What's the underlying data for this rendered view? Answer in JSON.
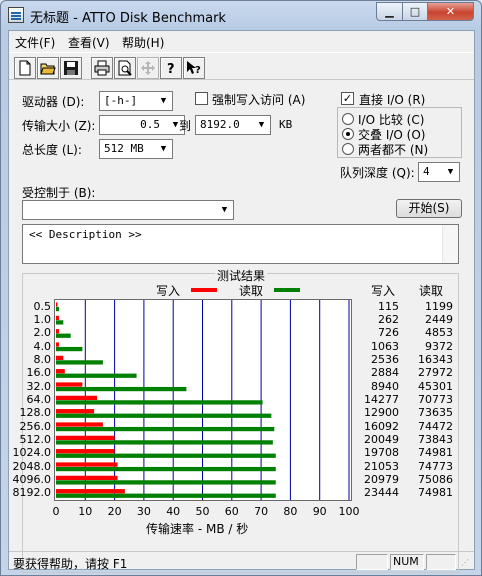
{
  "window": {
    "title": "无标题 - ATTO Disk Benchmark",
    "min_label": "▁",
    "max_label": "□",
    "close_label": "✕"
  },
  "menu": {
    "file": "文件(F)",
    "view": "查看(V)",
    "help": "帮助(H)"
  },
  "toolbar": {
    "icons": [
      "new-icon",
      "open-icon",
      "save-icon",
      "print-icon",
      "print-preview-icon",
      "move-icon",
      "help-icon",
      "context-help-icon"
    ]
  },
  "settings": {
    "drive_label": "驱动器 (D):",
    "drive_value": "[-h-]",
    "transfer_label": "传输大小 (Z):",
    "transfer_from": "0.5",
    "to_label": "到",
    "transfer_to": "8192.0",
    "kb_label": "KB",
    "length_label": "总长度 (L):",
    "length_value": "512 MB",
    "force_write_label": "强制写入访问 (A)",
    "direct_io_label": "直接 I/O (R)",
    "io_compare_label": "I/O 比较 (C)",
    "overlapped_io_label": "交叠 I/O (O)",
    "neither_label": "两者都不 (N)",
    "queue_depth_label": "队列深度 (Q):",
    "queue_depth_value": "4",
    "controlled_by_label": "受控制于 (B):",
    "controlled_by_value": "",
    "start_label": "开始(S)",
    "description_text": "<< Description >>"
  },
  "results": {
    "title": "测试结果",
    "legend_write": "写入",
    "legend_read": "读取",
    "col_write": "写入",
    "col_read": "读取",
    "xlabel": "传输速率 - MB / 秒",
    "write_color": "#ff0000",
    "read_color": "#008000"
  },
  "chart_data": {
    "type": "bar",
    "orientation": "horizontal",
    "categories": [
      "0.5",
      "1.0",
      "2.0",
      "4.0",
      "8.0",
      "16.0",
      "32.0",
      "64.0",
      "128.0",
      "256.0",
      "512.0",
      "1024.0",
      "2048.0",
      "4096.0",
      "8192.0"
    ],
    "series": [
      {
        "name": "写入",
        "values": [
          0.5,
          1,
          1,
          1,
          2.5,
          3,
          9,
          14,
          13,
          16,
          20,
          20,
          21,
          21,
          23.5
        ],
        "table": [
          115,
          262,
          726,
          1063,
          2536,
          2884,
          8940,
          14277,
          12900,
          16092,
          20049,
          19708,
          21053,
          20979,
          23444
        ]
      },
      {
        "name": "读取",
        "values": [
          1,
          2.5,
          5,
          9,
          16,
          27.5,
          44.5,
          70.5,
          73.5,
          74.5,
          74,
          75,
          75,
          75,
          75
        ],
        "table": [
          1199,
          2449,
          4853,
          9372,
          16343,
          27972,
          45301,
          70773,
          73635,
          74472,
          73843,
          74981,
          74773,
          75086,
          74981
        ]
      }
    ],
    "xticks": [
      "0",
      "10",
      "20",
      "30",
      "40",
      "50",
      "60",
      "70",
      "80",
      "90",
      "100"
    ],
    "xlim": [
      0,
      100
    ],
    "xlabel": "传输速率 - MB / 秒",
    "legend": "top"
  },
  "status": {
    "help_text": "要获得帮助，请按 F1",
    "num": "NUM"
  }
}
